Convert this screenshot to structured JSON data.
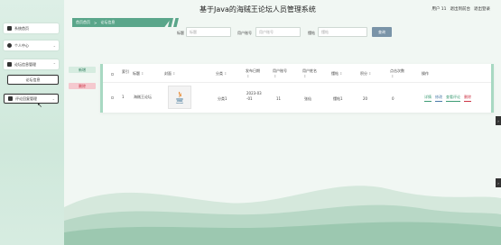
{
  "header": {
    "title": "基于Java的海贼王论坛人员管理系统",
    "user_label": "用户 11",
    "back_to_front": "退出到前台",
    "logout": "退出登录"
  },
  "sidebar": {
    "items": [
      {
        "label": "系统首页",
        "icon": "home-icon",
        "has_chevron": false
      },
      {
        "label": "个人中心",
        "icon": "user-icon",
        "has_chevron": true
      },
      {
        "label": "论坛信息管理",
        "icon": "flag-icon",
        "has_chevron": true
      },
      {
        "label": "论坛信息",
        "icon": "",
        "has_chevron": false,
        "sub": true
      },
      {
        "label": "评论回复管理",
        "icon": "comment-icon",
        "has_chevron": true
      }
    ]
  },
  "breadcrumb": {
    "home": "首页首页",
    "separator": ">",
    "current": "论坛信息"
  },
  "search": {
    "fields": [
      {
        "label": "标题",
        "placeholder": "标题"
      },
      {
        "label": "用户账号",
        "placeholder": "用户账号"
      },
      {
        "label": "懂帖",
        "placeholder": "懂帖"
      }
    ],
    "button_label": "查询"
  },
  "actions": {
    "add_label": "新增",
    "delete_label": "删除"
  },
  "table": {
    "columns": [
      "索引",
      "标题",
      "封面",
      "分类",
      "发布日期",
      "用户账号",
      "用户姓名",
      "懂帖",
      "积分",
      "点击次数",
      "操作"
    ],
    "rows": [
      {
        "index": "1",
        "title": "海贼王论坛",
        "cover_icon": "java-logo-icon",
        "category": "分类1",
        "publish_date": "2023-03-01",
        "account": "11",
        "name": "张仙",
        "type": "懂帖1",
        "points": "20",
        "clicks": "0",
        "row_actions": [
          "详情",
          "修改",
          "查看评论",
          "删除"
        ]
      }
    ]
  },
  "colors": {
    "accent": "#5aa68a",
    "search_button": "#7a94a8",
    "delete": "#cc3344"
  }
}
